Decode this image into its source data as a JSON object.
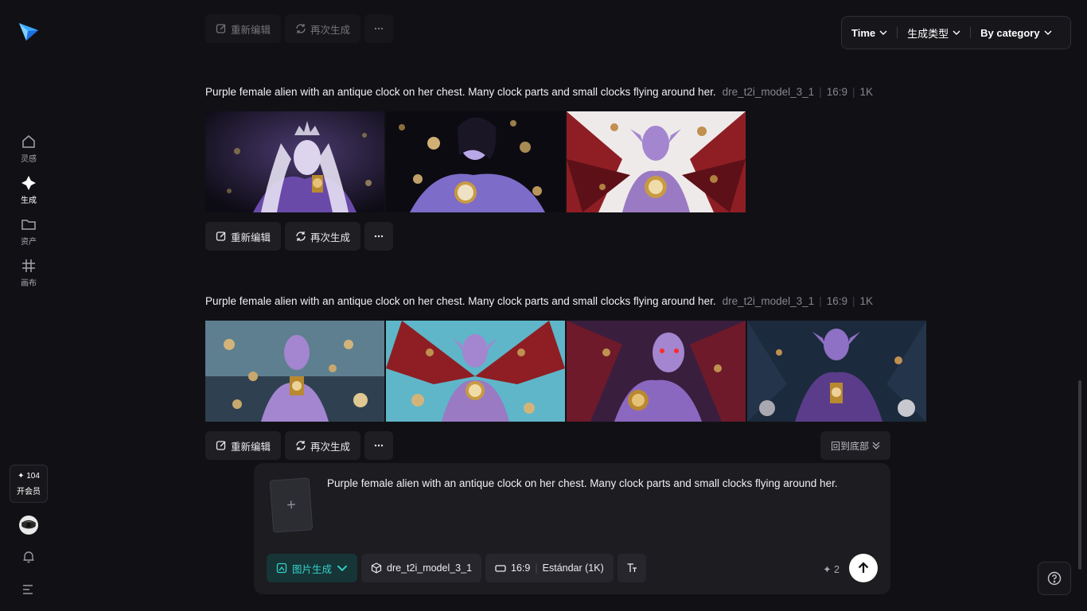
{
  "sidebar": {
    "items": [
      {
        "label": "灵感",
        "icon": "home-icon"
      },
      {
        "label": "生成",
        "icon": "sparkle-icon"
      },
      {
        "label": "资产",
        "icon": "folder-icon"
      },
      {
        "label": "画布",
        "icon": "grid-icon"
      }
    ],
    "credits": "✦ 104",
    "vip_label": "开会员"
  },
  "filters": {
    "time": "Time",
    "type": "生成类型",
    "category": "By category"
  },
  "actions": {
    "reedit": "重新编辑",
    "regenerate": "再次生成"
  },
  "generations": [
    {
      "prompt": "Purple female alien with an antique clock on her chest. Many clock parts and small clocks flying around her.",
      "model": "dre_t2i_model_3_1",
      "ratio": "16:9",
      "quality": "1K",
      "images": [
        "purple-elf-crown",
        "purple-woman-pocket-watches",
        "purple-demon-red-wings"
      ]
    },
    {
      "prompt": "Purple female alien with an antique clock on her chest. Many clock parts and small clocks flying around her.",
      "model": "dre_t2i_model_3_1",
      "ratio": "16:9",
      "quality": "1K",
      "images": [
        "alien-blue-background",
        "alien-bat-wings",
        "alien-red-eyes",
        "alien-dark-forest"
      ]
    }
  ],
  "back_to_bottom": "回到底部",
  "composer": {
    "text": "Purple female alien with an antique clock on her chest. Many clock parts and small clocks flying around her.",
    "add_symbol": "+",
    "mode": "图片生成",
    "model": "dre_t2i_model_3_1",
    "ratio": "16:9",
    "resolution": "Estándar (1K)",
    "cost": "✦ 2"
  },
  "colors": {
    "background": "#111115",
    "accent": "#33d2c9",
    "logo_blue": "#3aa8ff"
  }
}
